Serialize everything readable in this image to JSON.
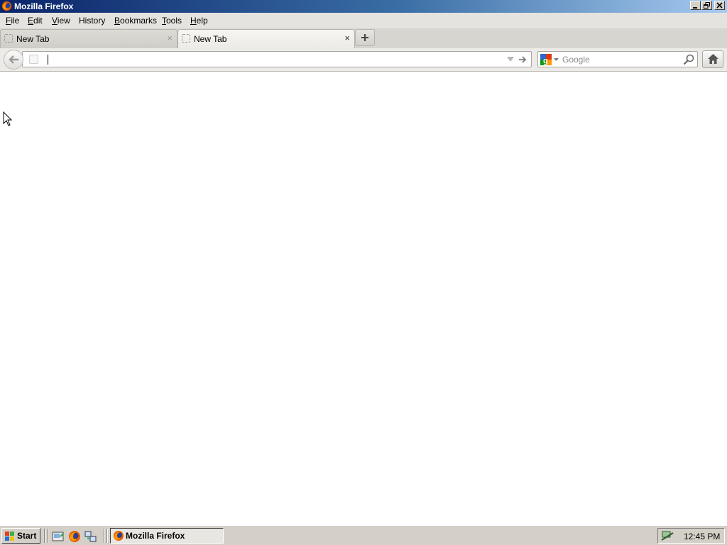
{
  "window": {
    "title": "Mozilla Firefox"
  },
  "menubar": {
    "items": [
      {
        "label": "File",
        "u": "F",
        "rest": "ile"
      },
      {
        "label": "Edit",
        "u": "E",
        "rest": "dit"
      },
      {
        "label": "View",
        "u": "V",
        "rest": "iew"
      },
      {
        "label": "History",
        "u": "",
        "rest": "History"
      },
      {
        "label": "Bookmarks",
        "u": "B",
        "rest": "ookmarks"
      },
      {
        "label": "Tools",
        "u": "T",
        "rest": "ools"
      },
      {
        "label": "Help",
        "u": "H",
        "rest": "elp"
      }
    ]
  },
  "tabs": [
    {
      "label": "New Tab",
      "active": false,
      "close": "×"
    },
    {
      "label": "New Tab",
      "active": true,
      "close": "×"
    }
  ],
  "newtab": {
    "icon": "plus-icon"
  },
  "urlbar": {
    "value": "",
    "placeholder": ""
  },
  "search": {
    "engine": "Google",
    "placeholder": "Google",
    "value": ""
  },
  "taskbar": {
    "start_label": "Start",
    "task_label": "Mozilla Firefox",
    "clock": "12:45 PM",
    "quick_launch": [
      "desktop-icon",
      "firefox-icon",
      "network-icon"
    ]
  },
  "colors": {
    "titlebar_start": "#0a246a",
    "titlebar_end": "#a6caf0",
    "taskbar": "#d4d0c8"
  }
}
